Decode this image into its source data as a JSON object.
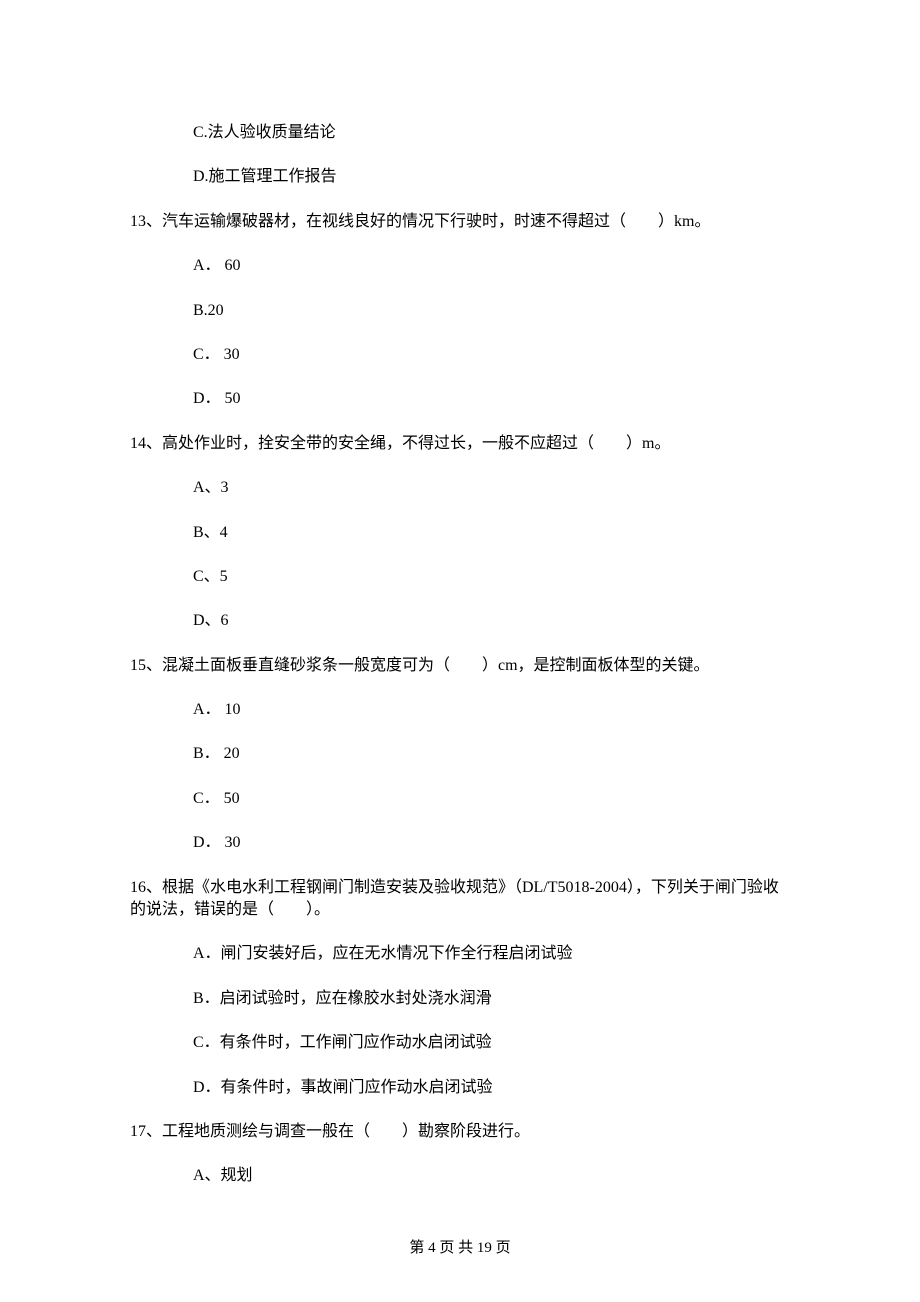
{
  "q12": {
    "optC": "C.法人验收质量结论",
    "optD": "D.施工管理工作报告"
  },
  "q13": {
    "stem": "13、汽车运输爆破器材，在视线良好的情况下行驶时，时速不得超过（　　）km。",
    "optA": "A． 60",
    "optB": "B.20",
    "optC": "C． 30",
    "optD": "D． 50"
  },
  "q14": {
    "stem": "14、高处作业时，拴安全带的安全绳，不得过长，一般不应超过（　　）m。",
    "optA": "A、3",
    "optB": "B、4",
    "optC": "C、5",
    "optD": "D、6"
  },
  "q15": {
    "stem": "15、混凝土面板垂直缝砂浆条一般宽度可为（　　）cm，是控制面板体型的关键。",
    "optA": "A． 10",
    "optB": "B． 20",
    "optC": "C． 50",
    "optD": "D． 30"
  },
  "q16": {
    "stem": "16、根据《水电水利工程钢闸门制造安装及验收规范》（DL/T5018-2004），下列关于闸门验收的说法，错误的是（　　）。",
    "optA": "A．闸门安装好后，应在无水情况下作全行程启闭试验",
    "optB": "B．启闭试验时，应在橡胶水封处浇水润滑",
    "optC": "C．有条件时，工作闸门应作动水启闭试验",
    "optD": "D．有条件时，事故闸门应作动水启闭试验"
  },
  "q17": {
    "stem": "17、工程地质测绘与调查一般在（　　）勘察阶段进行。",
    "optA": "A、规划"
  },
  "footer": "第 4 页 共 19 页"
}
